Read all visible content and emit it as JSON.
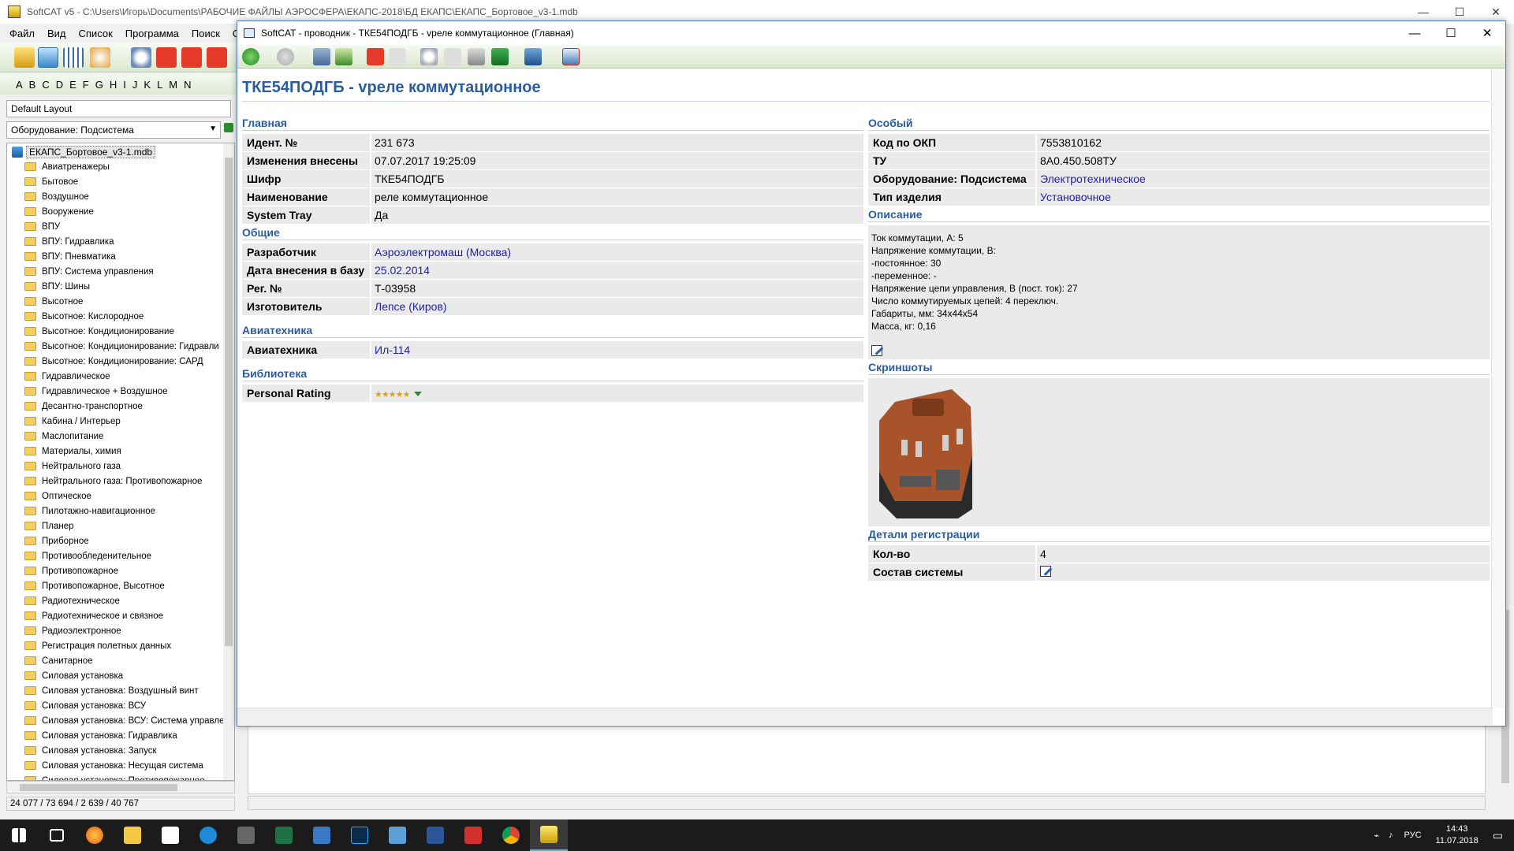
{
  "main_window": {
    "title": "SoftCAT v5 - C:\\Users\\Игорь\\Documents\\РАБОЧИЕ ФАЙЛЫ АЭРОСФЕРА\\ЕКАПС-2018\\БД ЕКАПС\\ЕКАПС_Бортовое_v3-1.mdb",
    "menu": [
      "Файл",
      "Вид",
      "Список",
      "Программа",
      "Поиск",
      "О"
    ],
    "alphabet": [
      "A",
      "B",
      "C",
      "D",
      "E",
      "F",
      "G",
      "H",
      "I",
      "J",
      "K",
      "L",
      "M",
      "N"
    ],
    "layout_value": "Default Layout",
    "subsystem_value": "Оборудование: Подсистема",
    "tree_root": "ЕКАПС_Бортовое_v3-1.mdb",
    "tree_items": [
      "Авиатренажеры",
      "Бытовое",
      "Воздушное",
      "Вооружение",
      "ВПУ",
      "ВПУ: Гидравлика",
      "ВПУ: Пневматика",
      "ВПУ: Система управления",
      "ВПУ: Шины",
      "Высотное",
      "Высотное: Кислородное",
      "Высотное: Кондиционирование",
      "Высотное: Кондиционирование: Гидравли",
      "Высотное: Кондиционирование: САРД",
      "Гидравлическое",
      "Гидравлическое + Воздушное",
      "Десантно-транспортное",
      "Кабина / Интерьер",
      "Маслопитание",
      "Материалы, химия",
      "Нейтрального газа",
      "Нейтрального газа: Противопожарное",
      "Оптическое",
      "Пилотажно-навигационное",
      "Планер",
      "Приборное",
      "Противообледенительное",
      "Противопожарное",
      "Противопожарное, Высотное",
      "Радиотехническое",
      "Радиотехническое и связное",
      "Радиоэлектронное",
      "Регистрация полетных данных",
      "Санитарное",
      "Силовая установка",
      "Силовая установка: Воздушный винт",
      "Силовая установка: ВСУ",
      "Силовая установка: ВСУ: Система управле",
      "Силовая установка: Гидравлика",
      "Силовая установка: Запуск",
      "Силовая установка: Несущая система",
      "Силовая установка: Противопожарное"
    ],
    "status": "24 077 / 73 694 / 2 639 / 40 767"
  },
  "child_window": {
    "title": "SoftCAT - проводник - ТКЕ54ПОДГБ - vреле коммутационное (Главная)",
    "heading": "ТКЕ54ПОДГБ - vреле коммутационное",
    "left": {
      "main_section": "Главная",
      "main_rows": [
        {
          "k": "Идент. №",
          "v": "231 673"
        },
        {
          "k": "Изменения внесены",
          "v": "07.07.2017 19:25:09"
        },
        {
          "k": "Шифр",
          "v": "ТКЕ54ПОДГБ"
        },
        {
          "k": "Наименование",
          "v": "реле коммутационное"
        },
        {
          "k": "System Tray",
          "v": "Да"
        }
      ],
      "general_section": "Общие",
      "general_rows": [
        {
          "k": "Разработчик",
          "v": "Аэроэлектромаш (Москва)"
        },
        {
          "k": "Дата внесения в базу",
          "v": "25.02.2014"
        },
        {
          "k": "Рег. №",
          "v": "Т-03958"
        },
        {
          "k": "Изготовитель",
          "v": "Лепсе (Киров)"
        }
      ],
      "avia_section": "Авиатехника",
      "avia_rows": [
        {
          "k": "Авиатехника",
          "v": "Ил-114"
        }
      ],
      "library_section": "Библиотека",
      "library_rows": [
        {
          "k": "Personal Rating",
          "v": "★★★★★"
        }
      ]
    },
    "right": {
      "special_section": "Особый",
      "special_rows": [
        {
          "k": "Код по ОКП",
          "v": "7553810162"
        },
        {
          "k": "ТУ",
          "v": "8А0.450.508ТУ"
        },
        {
          "k": "Оборудование: Подсистема",
          "v": "Электротехническое"
        },
        {
          "k": "Тип изделия",
          "v": "Установочное"
        }
      ],
      "desc_section": "Описание",
      "desc_lines": [
        "Ток коммутации, А: 5",
        "Напряжение коммутации, В:",
        "-постоянное: 30",
        "-переменное: -",
        "Напряжение цепи управления, В (пост. ток): 27",
        "Число коммутируемых цепей: 4 переключ.",
        "Габариты, мм: 34х44х54",
        "Масса, кг: 0,16"
      ],
      "shots_section": "Скриншоты",
      "reg_section": "Детали регистрации",
      "reg_rows": [
        {
          "k": "Кол-во",
          "v": "4"
        },
        {
          "k": "Состав системы",
          "v": ""
        }
      ]
    }
  },
  "taskbar": {
    "lang": "РУС",
    "time": "14:43",
    "date": "11.07.2018"
  },
  "colors": {
    "heading": "#2b5d9e",
    "link": "#2121a8",
    "row_bg": "#eaeaea"
  }
}
